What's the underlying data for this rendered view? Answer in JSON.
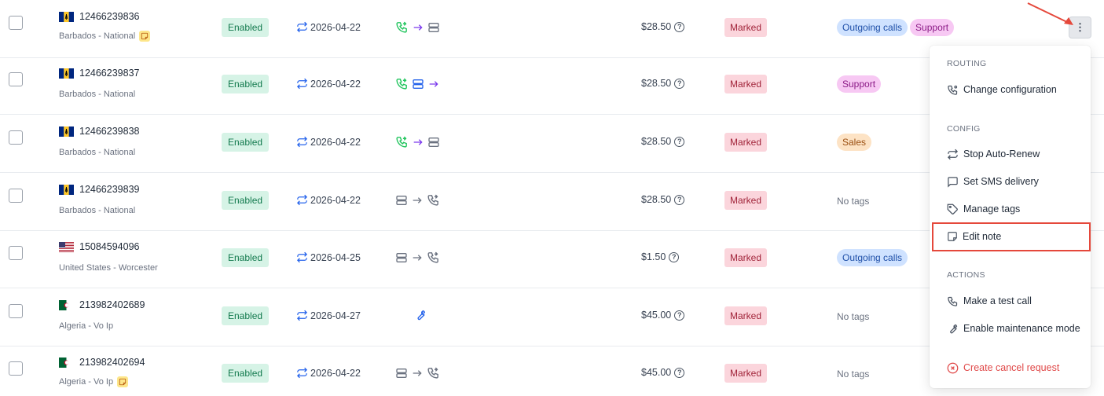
{
  "rows": [
    {
      "number": "12466239836",
      "flag": "bb",
      "location": "Barbados - National",
      "has_note": true,
      "status": "Enabled",
      "renew_date": "2026-04-22",
      "route": "phone-forward-server",
      "price": "$28.50",
      "mark": "Marked",
      "tags": [
        "Outgoing calls",
        "Support"
      ],
      "no_tags": ""
    },
    {
      "number": "12466239837",
      "flag": "bb",
      "location": "Barbados - National",
      "has_note": false,
      "status": "Enabled",
      "renew_date": "2026-04-22",
      "route": "phone-server-forward",
      "price": "$28.50",
      "mark": "Marked",
      "tags": [
        "Support"
      ],
      "no_tags": ""
    },
    {
      "number": "12466239838",
      "flag": "bb",
      "location": "Barbados - National",
      "has_note": false,
      "status": "Enabled",
      "renew_date": "2026-04-22",
      "route": "phone-forward-server",
      "price": "$28.50",
      "mark": "Marked",
      "tags": [
        "Sales"
      ],
      "no_tags": ""
    },
    {
      "number": "12466239839",
      "flag": "bb",
      "location": "Barbados - National",
      "has_note": false,
      "status": "Enabled",
      "renew_date": "2026-04-22",
      "route": "server-arrow-phone",
      "price": "$28.50",
      "mark": "Marked",
      "tags": [],
      "no_tags": "No tags"
    },
    {
      "number": "15084594096",
      "flag": "us",
      "location": "United States - Worcester",
      "has_note": false,
      "status": "Enabled",
      "renew_date": "2026-04-25",
      "route": "server-arrow-phone",
      "price": "$1.50",
      "mark": "Marked",
      "tags": [
        "Outgoing calls"
      ],
      "no_tags": ""
    },
    {
      "number": "213982402689",
      "flag": "dz",
      "location": "Algeria - Vo Ip",
      "has_note": false,
      "status": "Enabled",
      "renew_date": "2026-04-27",
      "route": "wrench",
      "price": "$45.00",
      "mark": "Marked",
      "tags": [],
      "no_tags": "No tags"
    },
    {
      "number": "213982402694",
      "flag": "dz",
      "location": "Algeria - Vo Ip",
      "has_note": true,
      "status": "Enabled",
      "renew_date": "2026-04-22",
      "route": "server-arrow-phone",
      "price": "$45.00",
      "mark": "Marked",
      "tags": [],
      "no_tags": "No tags"
    }
  ],
  "menu": {
    "routing_title": "ROUTING",
    "change_configuration": "Change configuration",
    "config_title": "CONFIG",
    "stop_auto_renew": "Stop Auto-Renew",
    "set_sms_delivery": "Set SMS delivery",
    "manage_tags": "Manage tags",
    "edit_note": "Edit note",
    "actions_title": "ACTIONS",
    "make_test_call": "Make a test call",
    "enable_maintenance": "Enable maintenance mode",
    "create_cancel_request": "Create cancel request"
  },
  "kebab_label": "⋮",
  "colors": {
    "enabled_bg": "#d6f3e6",
    "marked_bg": "#fbd5dc",
    "accent_blue": "#2563eb",
    "route_green": "#22c55e",
    "route_purple": "#7c3aed",
    "annotation_red": "#e5483b"
  }
}
